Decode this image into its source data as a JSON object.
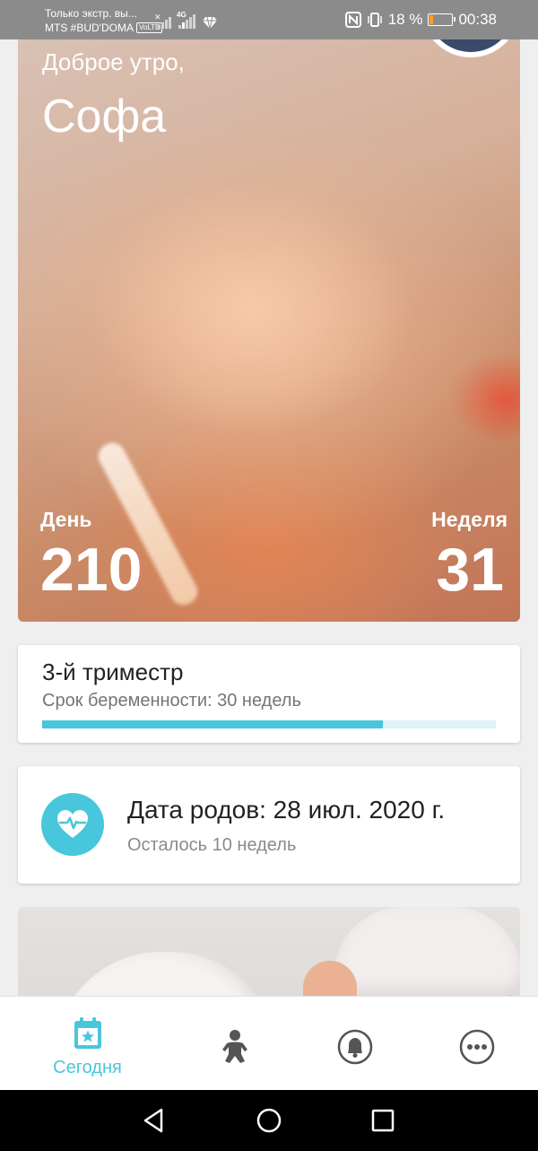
{
  "status_bar": {
    "carrier_line1": "Только экстр. вы...",
    "carrier_line2": "MTS #BUD'DOMA",
    "volte": "VoLTE",
    "network": "4G",
    "battery_percent": "18 %",
    "battery_level": 0.18,
    "time": "00:38"
  },
  "hero": {
    "greeting": "Доброе утро,",
    "name": "Софа",
    "day_label": "День",
    "day_value": "210",
    "week_label": "Неделя",
    "week_value": "31"
  },
  "trimester": {
    "title": "3-й триместр",
    "subtitle": "Срок беременности: 30 недель",
    "progress": 0.75
  },
  "due_date": {
    "title": "Дата родов: 28 июл. 2020 г.",
    "subtitle": "Осталось 10 недель",
    "icon": "heart-pulse-icon"
  },
  "bottom_nav": {
    "items": [
      {
        "label": "Сегодня",
        "icon": "calendar-star-icon",
        "active": true
      },
      {
        "label": "",
        "icon": "baby-icon",
        "active": false
      },
      {
        "label": "",
        "icon": "bell-icon",
        "active": false
      },
      {
        "label": "",
        "icon": "more-icon",
        "active": false
      }
    ]
  },
  "colors": {
    "accent": "#48c6db",
    "progress_track": "#dcf3f7",
    "status_bar": "#8b8b8b"
  }
}
